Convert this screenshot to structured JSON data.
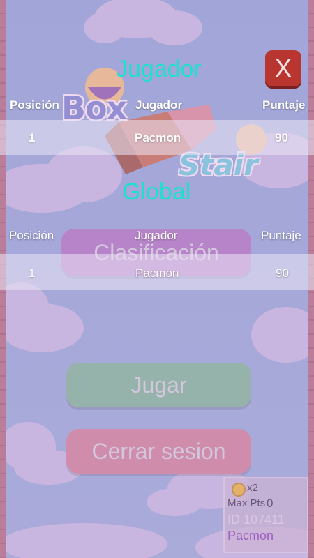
{
  "background": {
    "logo_word1": "Box",
    "logo_word2": "Stair",
    "menu": {
      "clasificacion_label": "Clasificación",
      "jugar_label": "Jugar",
      "cerrar_label": "Cerrar sesion"
    },
    "player_card": {
      "multiplier": "x2",
      "max_pts_label": "Max Pts",
      "max_pts_value": "0",
      "id_text": "ID 107411",
      "name": "Pacmon"
    }
  },
  "leaderboard": {
    "close_label": "X",
    "player_section": {
      "title": "Jugador",
      "headers": {
        "position": "Posición",
        "player": "Jugador",
        "score": "Puntaje"
      },
      "rows": [
        {
          "position": "1",
          "player": "Pacmon",
          "score": "90"
        }
      ]
    },
    "global_section": {
      "title": "Global",
      "headers": {
        "position": "Posición",
        "player": "Jugador",
        "score": "Puntaje"
      },
      "rows": [
        {
          "position": "1",
          "player": "Pacmon",
          "score": "90"
        }
      ]
    }
  },
  "colors": {
    "title_cyan": "#1fe0cf",
    "close_red": "#b83530",
    "jugar_green": "#6faa8c",
    "cerrar_pink": "#c5708c",
    "clasif_purple": "#a165b8"
  }
}
